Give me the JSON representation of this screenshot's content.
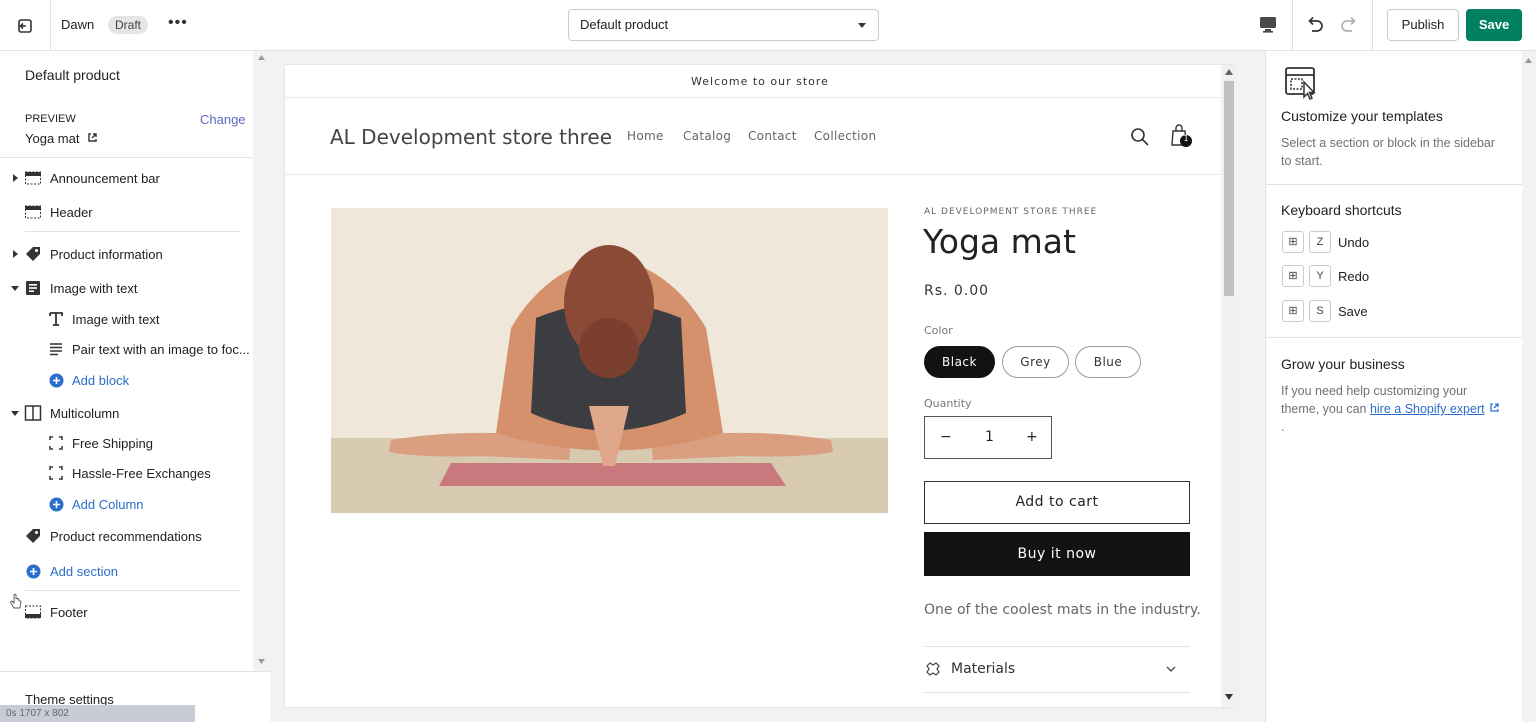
{
  "topbar": {
    "theme_name": "Dawn",
    "status_badge": "Draft",
    "more": "•••",
    "template_select": "Default product",
    "publish_label": "Publish",
    "save_label": "Save"
  },
  "sidebar": {
    "title": "Default product",
    "preview_label": "PREVIEW",
    "change_label": "Change",
    "preview_product": "Yoga mat",
    "sections": [
      {
        "label": "Announcement bar",
        "icon": "announcement-bar-icon"
      },
      {
        "label": "Header",
        "icon": "header-layout-icon"
      },
      {
        "label": "Product information",
        "icon": "tag-icon"
      },
      {
        "label": "Image with text",
        "icon": "image-with-text-icon"
      },
      {
        "label": "Image with text",
        "icon": "text-t-icon"
      },
      {
        "label": "Pair text with an image to foc...",
        "icon": "text-lines-icon"
      },
      {
        "label": "Add block",
        "icon": "plus-circle-icon"
      },
      {
        "label": "Multicolumn",
        "icon": "columns-icon"
      },
      {
        "label": "Free Shipping",
        "icon": "block-frame-icon"
      },
      {
        "label": "Hassle-Free Exchanges",
        "icon": "block-frame-icon"
      },
      {
        "label": "Add Column",
        "icon": "plus-circle-icon"
      },
      {
        "label": "Product recommendations",
        "icon": "tag-icon"
      },
      {
        "label": "Add section",
        "icon": "plus-circle-icon"
      },
      {
        "label": "Footer",
        "icon": "footer-layout-icon"
      }
    ],
    "theme_settings": "Theme settings",
    "recorder_overlay": "0s   1707 x 802"
  },
  "preview": {
    "announcement": "Welcome to our store",
    "store_name": "AL Development store three",
    "nav": [
      "Home",
      "Catalog",
      "Contact",
      "Collection"
    ],
    "cart_count": "1",
    "vendor": "AL DEVELOPMENT STORE THREE",
    "product_title": "Yoga mat",
    "price": "Rs. 0.00",
    "color_label": "Color",
    "colors": [
      "Black",
      "Grey",
      "Blue"
    ],
    "selected_color": "Black",
    "quantity_label": "Quantity",
    "qty_minus": "−",
    "qty_value": "1",
    "qty_plus": "+",
    "add_to_cart": "Add to cart",
    "buy_now": "Buy it now",
    "description": "One of the coolest mats in the industry.",
    "accordion_label": "Materials"
  },
  "right_panel": {
    "customize_title": "Customize your templates",
    "customize_text": "Select a section or block in the sidebar to start.",
    "shortcuts_title": "Keyboard shortcuts",
    "shortcuts": [
      {
        "key": "Z",
        "label": "Undo"
      },
      {
        "key": "Y",
        "label": "Redo"
      },
      {
        "key": "S",
        "label": "Save"
      }
    ],
    "grow_title": "Grow your business",
    "grow_text_before": "If you need help customizing your theme, you can ",
    "grow_link": "hire a Shopify expert",
    "grow_text_after": " ."
  },
  "colors": {
    "accent_green": "#008060",
    "link_blue": "#2c6ecb",
    "change_link": "#5c6ac4",
    "button_dark": "#121212"
  }
}
